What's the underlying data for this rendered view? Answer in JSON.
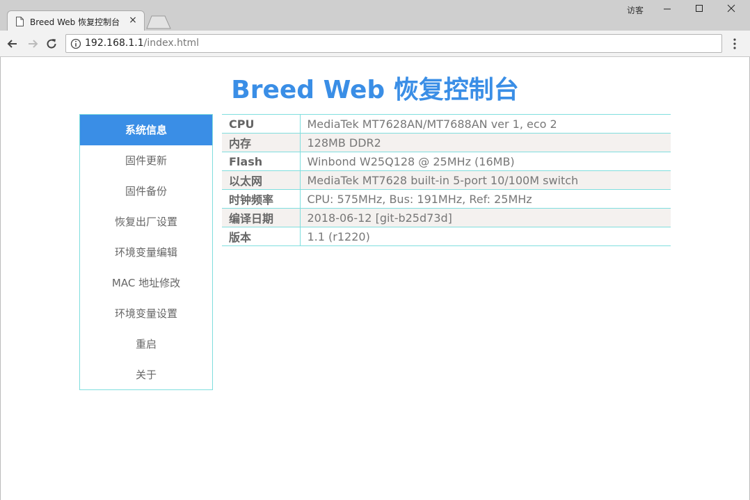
{
  "browser": {
    "tab_title": "Breed Web 恢复控制台",
    "tab_close": "×",
    "guest_label": "访客",
    "url_host": "192.168.1.1",
    "url_path": "/index.html"
  },
  "page": {
    "title": "Breed Web 恢复控制台"
  },
  "sidebar": {
    "items": [
      {
        "label": "系统信息",
        "active": true
      },
      {
        "label": "固件更新"
      },
      {
        "label": "固件备份"
      },
      {
        "label": "恢复出厂设置"
      },
      {
        "label": "环境变量编辑"
      },
      {
        "label": "MAC 地址修改"
      },
      {
        "label": "环境变量设置"
      },
      {
        "label": "重启"
      },
      {
        "label": "关于"
      }
    ]
  },
  "system_info": [
    {
      "key": "CPU",
      "value": "MediaTek MT7628AN/MT7688AN ver 1, eco 2"
    },
    {
      "key": "内存",
      "value": "128MB DDR2"
    },
    {
      "key": "Flash",
      "value": "Winbond W25Q128 @ 25MHz (16MB)"
    },
    {
      "key": "以太网",
      "value": "MediaTek MT7628 built-in 5-port 10/100M switch"
    },
    {
      "key": "时钟频率",
      "value": "CPU: 575MHz, Bus: 191MHz, Ref: 25MHz"
    },
    {
      "key": "编译日期",
      "value": "2018-06-12 [git-b25d73d]"
    },
    {
      "key": "版本",
      "value": "1.1 (r1220)"
    }
  ],
  "colors": {
    "accent": "#3a8ee6",
    "border": "#7fdede",
    "row_alt": "#f4f1ef"
  }
}
